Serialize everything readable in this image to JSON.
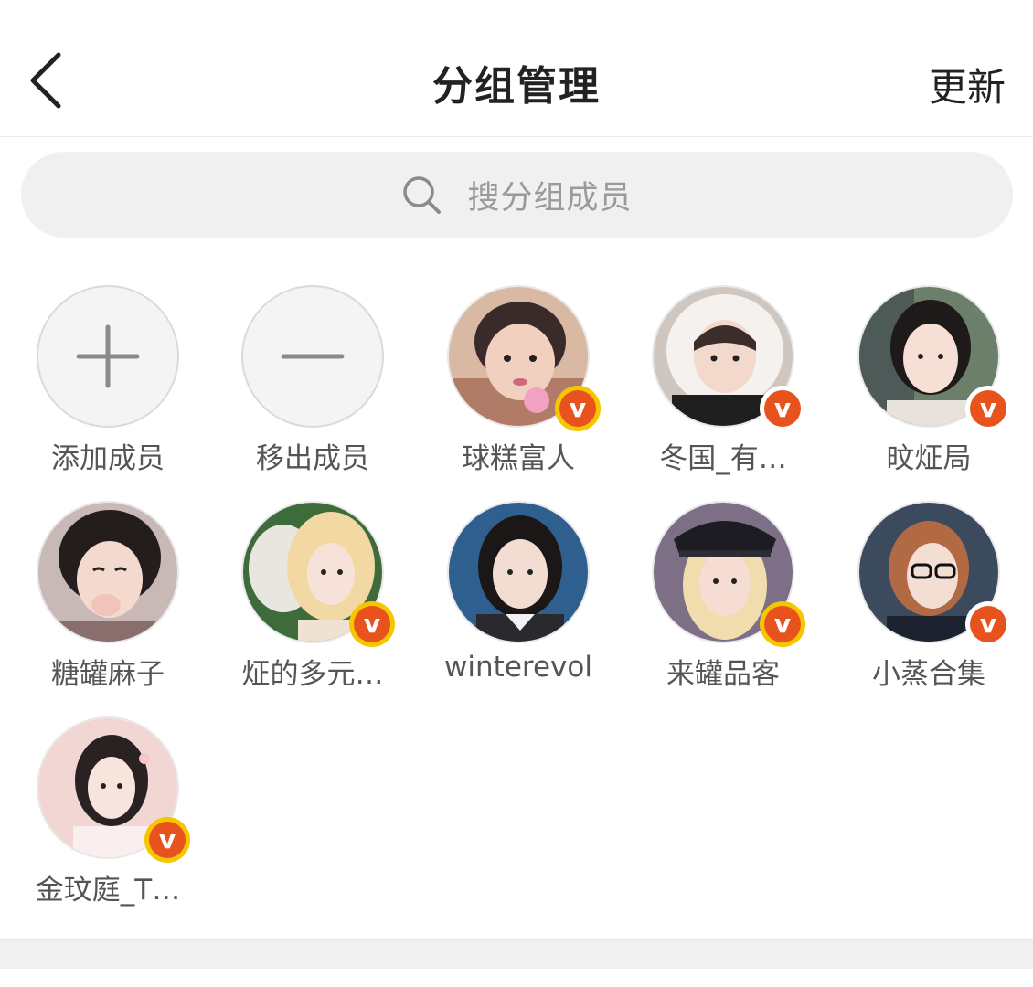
{
  "header": {
    "title": "分组管理",
    "update_label": "更新"
  },
  "search": {
    "placeholder": "搜分组成员"
  },
  "actions": {
    "add_label": "添加成员",
    "remove_label": "移出成员"
  },
  "members": [
    {
      "name": "球糕富人",
      "verified": true,
      "badge": "yellow",
      "avatar": "child-photo"
    },
    {
      "name": "冬国_有…",
      "verified": true,
      "badge": "orange",
      "avatar": "furry-hood-photo"
    },
    {
      "name": "旼炡局",
      "verified": true,
      "badge": "orange",
      "avatar": "portrait-photo"
    },
    {
      "name": "糖罐麻子",
      "verified": false,
      "avatar": "blow-kiss-photo"
    },
    {
      "name": "炡的多元…",
      "verified": true,
      "badge": "yellow",
      "avatar": "blonde-photo"
    },
    {
      "name": "winterevol",
      "verified": false,
      "avatar": "school-photo"
    },
    {
      "name": "来罐品客",
      "verified": true,
      "badge": "yellow",
      "avatar": "cap-photo"
    },
    {
      "name": "小蒸合集",
      "verified": true,
      "badge": "orange",
      "avatar": "glasses-photo"
    },
    {
      "name": "金玟庭_T…",
      "verified": true,
      "badge": "yellow",
      "avatar": "winter-photo"
    }
  ],
  "colors": {
    "badge_yellow": "#f6c600",
    "badge_orange": "#e8531d",
    "search_bg": "#f0f0f0",
    "text_dark": "#222222",
    "text_muted": "#555555"
  }
}
